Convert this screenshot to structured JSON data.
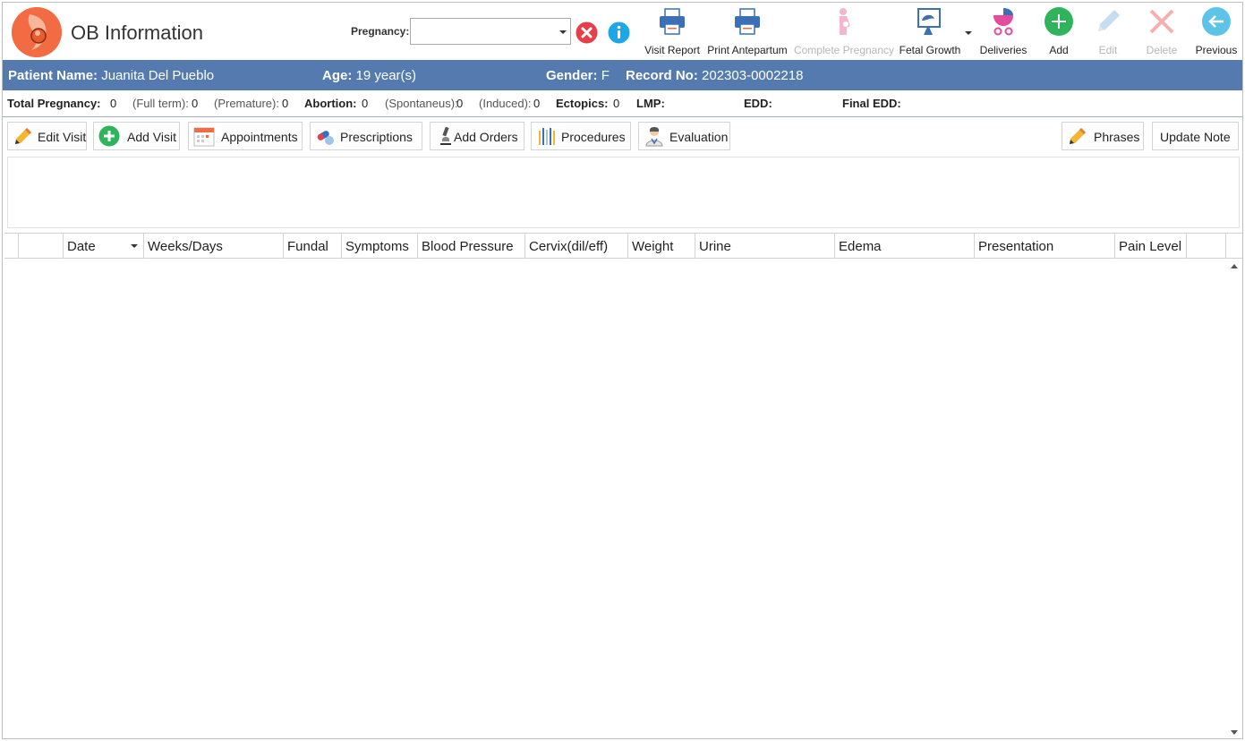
{
  "header": {
    "title": "OB Information",
    "pregnancy_label": "Pregnancy:",
    "pregnancy_value": ""
  },
  "toolbar": {
    "visit_report": "Visit Report",
    "print_antepartum": "Print Antepartum",
    "complete_pregnancy": "Complete Pregnancy",
    "fetal_growth": "Fetal Growth",
    "deliveries": "Deliveries",
    "add": "Add",
    "edit": "Edit",
    "delete": "Delete",
    "previous": "Previous"
  },
  "patient": {
    "name_label": "Patient Name:",
    "name": "Juanita Del Pueblo",
    "age_label": "Age:",
    "age": "19 year(s)",
    "gender_label": "Gender:",
    "gender": "F",
    "record_label": "Record No:",
    "record": "202303-0002218"
  },
  "stats": {
    "total_label": "Total Pregnancy:",
    "total": "0",
    "fullterm_label": "(Full term):",
    "fullterm": "0",
    "premature_label": "(Premature):",
    "premature": "0",
    "abortion_label": "Abortion:",
    "abortion": "0",
    "spontaneus_label": "(Spontaneus):",
    "spontaneus": "0",
    "induced_label": "(Induced):",
    "induced": "0",
    "ectopics_label": "Ectopics:",
    "ectopics": "0",
    "lmp_label": "LMP:",
    "edd_label": "EDD:",
    "final_edd_label": "Final EDD:"
  },
  "actions": {
    "edit_visit": "Edit Visit",
    "add_visit": "Add Visit",
    "appointments": "Appointments",
    "prescriptions": "Prescriptions",
    "add_orders": "Add Orders",
    "procedures": "Procedures",
    "evaluation": "Evaluation",
    "phrases": "Phrases",
    "update_note": "Update Note"
  },
  "grid": {
    "columns": [
      "Date",
      "Weeks/Days",
      "Fundal",
      "Symptoms",
      "Blood Pressure",
      "Cervix(dil/eff)",
      "Weight",
      "Urine",
      "Edema",
      "Presentation",
      "Pain Level"
    ]
  },
  "colors": {
    "patient_bar": "#557ab0",
    "logo": "#f26b43",
    "add_green": "#2fb35b",
    "clear_red": "#e5404a",
    "info_blue": "#1ea7e8"
  }
}
